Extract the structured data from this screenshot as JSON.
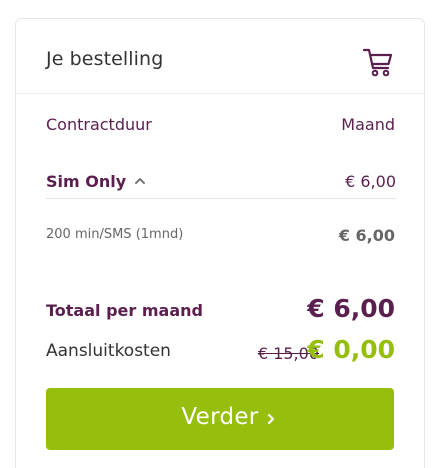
{
  "header": {
    "title": "Je bestelling",
    "icon": "cart-icon"
  },
  "contract": {
    "label": "Contractduur",
    "value": "Maand"
  },
  "sim": {
    "label": "Sim Only",
    "price": "€ 6,00",
    "icon": "chevron-up-icon"
  },
  "bundle": {
    "label": "200 min/SMS (1mnd)",
    "price": "€ 6,00"
  },
  "total": {
    "label": "Totaal per maand",
    "price": "€ 6,00"
  },
  "setup": {
    "label": "Aansluitkosten",
    "old_price": "€ 15,00",
    "new_price": "€ 0,00"
  },
  "cta": {
    "label": "Verder",
    "icon": "chevron-right-icon"
  },
  "colors": {
    "brand": "#5a1f4f",
    "accent": "#96be0d"
  }
}
